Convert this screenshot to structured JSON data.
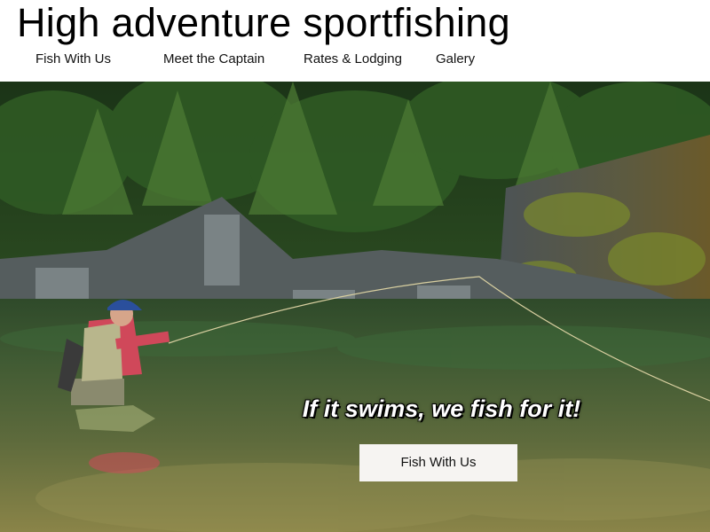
{
  "header": {
    "title": "High adventure sportfishing",
    "nav": [
      "Fish With Us",
      "Meet the Captain",
      "Rates & Lodging",
      "Galery"
    ]
  },
  "hero": {
    "tagline": "If it swims, we fish for it!",
    "cta_label": "Fish With Us"
  },
  "colors": {
    "forest": "#1f3a1a",
    "water": "#4a6e3a",
    "rock": "#5d6468",
    "jacket": "#d0485a",
    "cap": "#2a4f9c",
    "button_bg": "#f6f4f2"
  }
}
